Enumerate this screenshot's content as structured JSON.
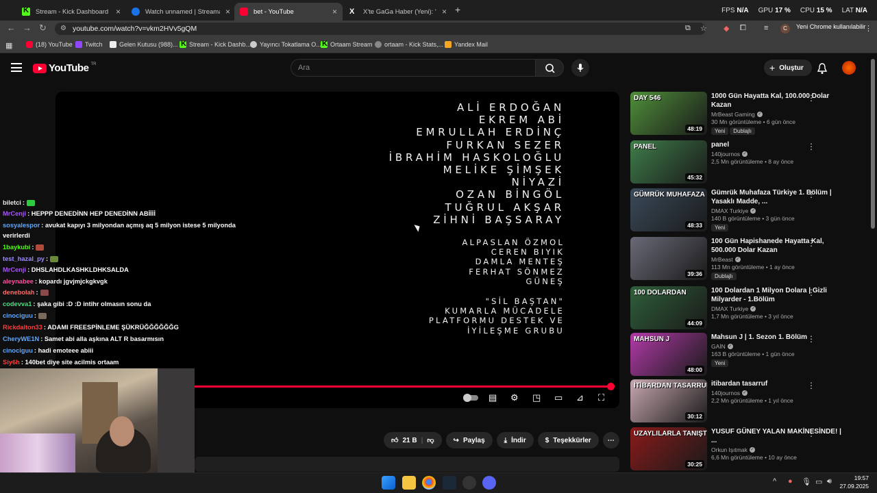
{
  "browser": {
    "tabs": [
      {
        "label": "Stream - Kick Dashboard",
        "favicon": "kick-icon",
        "active": false
      },
      {
        "label": "Watch unnamed | Streamable",
        "favicon": "streamable-icon",
        "active": false
      },
      {
        "label": "bet - YouTube",
        "favicon": "youtube-icon",
        "active": true
      },
      {
        "label": "X'te GaGa Haber (Yeni): \"Kadık",
        "favicon": "x-icon",
        "active": false
      }
    ],
    "new_tab": "+",
    "perf": {
      "fps_label": "FPS",
      "fps": "N/A",
      "gpu_label": "GPU",
      "gpu": "17 %",
      "cpu_label": "CPU",
      "cpu": "15 %",
      "lat_label": "LAT",
      "lat": "N/A"
    },
    "url": "youtube.com/watch?v=vkm2HVv5gQM",
    "profile_initial": "C",
    "update_label": "Yeni Chrome kullanılabilir",
    "bookmarks": [
      "(18) YouTube",
      "Twitch",
      "Gelen Kutusu (988)...",
      "Stream - Kick Dashb...",
      "Yayıncı Tokatlama O...",
      "Ortaam Stream",
      "ortaam - Kick Stats,...",
      "Yandex Mail"
    ]
  },
  "youtube": {
    "logo_text": "YouTube",
    "region": "TR",
    "search_placeholder": "Ara",
    "create_label": "Oluştur",
    "video": {
      "credits_main": [
        "ALİ ERDOĞAN",
        "EKREM ABİ",
        "EMRULLAH ERDİNÇ",
        "FURKAN SEZER",
        "İBRAHİM HASKOLOĞLU",
        "MELİKE ŞİMŞEK",
        "NİYAZİ",
        "OZAN BİNGÖL",
        "TUĞRUL AKŞAR",
        "ZİHNİ BAŞSARAY"
      ],
      "credits_second": [
        "ALPASLAN ÖZMOL",
        "CEREN BIYIK",
        "DAMLA MENTEŞ",
        "FERHAT SÖNMEZ",
        "GÜNEŞ"
      ],
      "credits_third": [
        "\"SİL BAŞTAN\"",
        "KUMARLA MÜCADELE",
        "PLATFORMU DESTEK VE",
        "İYİLEŞME GRUBU"
      ],
      "progress": 1.0
    },
    "actions": {
      "likes": "21 B",
      "share": "Paylaş",
      "download": "İndir",
      "thanks": "Teşekkürler"
    },
    "recommendations": [
      {
        "thumb_text": "DAY 546",
        "title": "1000 Gün Hayatta Kal, 100.000 Dolar Kazan",
        "channel": "MrBeast Gaming",
        "meta": "30 Mn görüntüleme • 6 gün önce",
        "badges": [
          "Yeni",
          "Dublajlı"
        ],
        "duration": "48:19",
        "color": "#4f8f3a"
      },
      {
        "thumb_text": "PANEL",
        "title": "panel",
        "channel": "140journos",
        "meta": "2,5 Mn görüntüleme • 8 ay önce",
        "badges": [],
        "duration": "45:32",
        "color": "#3f7d4a"
      },
      {
        "thumb_text": "GÜMRÜK MUHAFAZA",
        "title": "Gümrük Muhafaza Türkiye 1. Bölüm | Yasaklı Madde, ...",
        "channel": "DMAX Turkiye",
        "meta": "140 B görüntüleme • 3 gün önce",
        "badges": [
          "Yeni"
        ],
        "duration": "48:33",
        "color": "#3a4a5a"
      },
      {
        "thumb_text": "",
        "title": "100 Gün Hapishanede Hayatta Kal, 500.000 Dolar Kazan",
        "channel": "MrBeast",
        "meta": "113 Mn görüntüleme • 1 ay önce",
        "badges": [
          "Dublajlı"
        ],
        "duration": "39:36",
        "color": "#6a6a78"
      },
      {
        "thumb_text": "100 DOLARDAN",
        "title": "100 Dolardan 1 Milyon Dolara | Gizli Milyarder - 1.Bölüm",
        "channel": "DMAX Turkiye",
        "meta": "1,7 Mn görüntüleme • 3 yıl önce",
        "badges": [],
        "duration": "44:09",
        "color": "#2f5f3a"
      },
      {
        "thumb_text": "MAHSUN J",
        "title": "Mahsun J | 1. Sezon 1. Bölüm",
        "channel": "GAİN",
        "meta": "163 B görüntüleme • 1 gün önce",
        "badges": [
          "Yeni"
        ],
        "duration": "48:00",
        "color": "#b23aa8"
      },
      {
        "thumb_text": "İTİBARDAN TASARRUF",
        "title": "itibardan tasarruf",
        "channel": "140journos",
        "meta": "2,2 Mn görüntüleme • 1 yıl önce",
        "badges": [],
        "duration": "30:12",
        "color": "#c8a8b0"
      },
      {
        "thumb_text": "UZAYLILARLA TANIŞT",
        "title": "YUSUF GÜNEY YALAN MAKİNESİNDE! | ...",
        "channel": "Orkun Işıtmak",
        "meta": "6,6 Mn görüntüleme • 10 ay önce",
        "badges": [],
        "duration": "30:25",
        "color": "#8a1a1a"
      }
    ]
  },
  "chat": [
    {
      "user": "biletci",
      "text": ":",
      "color": "#e8e8e8",
      "emote": "#2ecc40"
    },
    {
      "user": "MrCenji",
      "text": ": HEPPP DENEDİNN HEP DENEDİNN ABİİİİ",
      "color": "#a855f7"
    },
    {
      "user": "sosyalespor",
      "text": ": avukat kapıyı 3 milyondan açmış aq 5 milyon istese 5 milyonda",
      "color": "#5fa8ff"
    },
    {
      "user": "",
      "text": "verirlerdi",
      "color": "#fff"
    },
    {
      "user": "1baykubi",
      "text": ":",
      "color": "#53fc18",
      "emote": "#b04a3a"
    },
    {
      "user": "test_hazal_py",
      "text": ":",
      "color": "#9b8cff",
      "emote": "#6a8a3a"
    },
    {
      "user": "MrCenji",
      "text": ": DHSLAHDLKASHKLDHKSALDA",
      "color": "#a855f7"
    },
    {
      "user": "aleynabee",
      "text": ": kopardı jgvjmjckgkvgk",
      "color": "#ff4fa0"
    },
    {
      "user": "denebolah",
      "text": ":",
      "color": "#ff6b6b",
      "emote": "#8a4a4a"
    },
    {
      "user": "codevva1",
      "text": ": şaka gibi :D :D intihr olmasın sonu da",
      "color": "#4ade80"
    },
    {
      "user": "cinociguu",
      "text": ":",
      "color": "#5fa8ff",
      "emote": "#7a6a5a"
    },
    {
      "user": "Rickdalton33",
      "text": ": ADAMI FREESPİNLEME ŞÜKRÜĞĞĞĞĞĞG",
      "color": "#ff3b3b"
    },
    {
      "user": "CheryWE1N",
      "text": ": Samet abi alla aşkına ALT R basarmısın",
      "color": "#5fa8ff"
    },
    {
      "user": "cinociguu",
      "text": ": hadi emoteee abiii",
      "color": "#5fa8ff"
    },
    {
      "user": "Siy6h",
      "text": ": 140bet diye site acilmis ortaam",
      "color": "#ff3b3b"
    }
  ],
  "taskbar": {
    "time": "19:57",
    "date": "27.09.2025"
  }
}
